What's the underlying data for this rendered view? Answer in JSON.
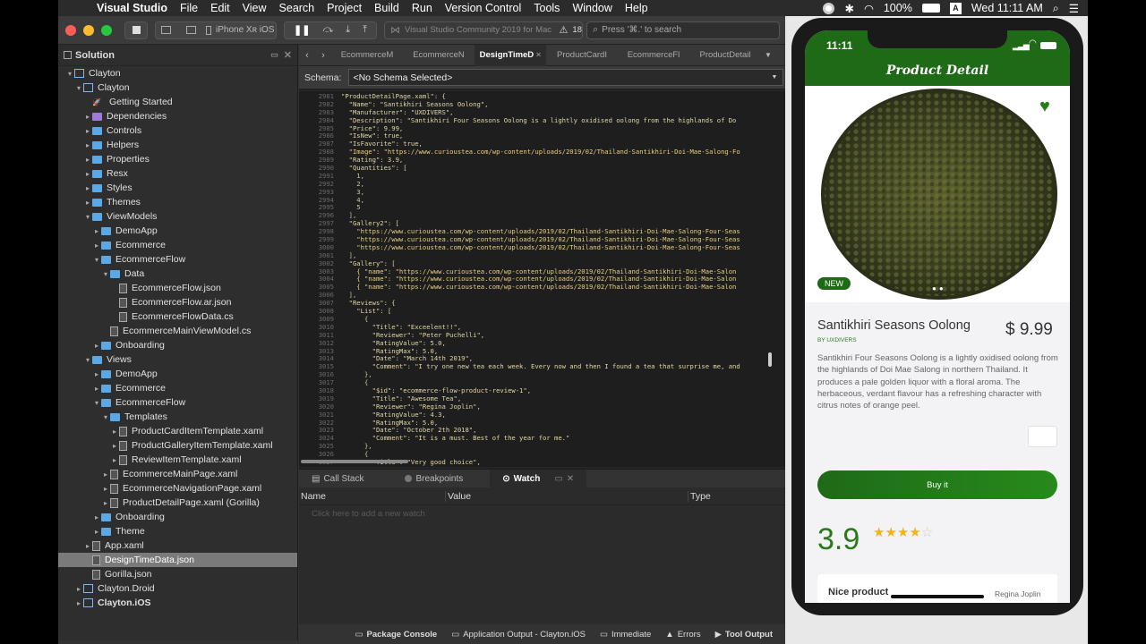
{
  "menubar": {
    "app": "Visual Studio",
    "items": [
      "File",
      "Edit",
      "View",
      "Search",
      "Project",
      "Build",
      "Run",
      "Version Control",
      "Tools",
      "Window",
      "Help"
    ],
    "battery": "100%",
    "clock": "Wed 11:11 AM"
  },
  "toolbar": {
    "device": "iPhone Xʀ iOS",
    "status": "Visual Studio Community 2019 for Mac",
    "warnings": "18",
    "search_placeholder": "Press '⌘.' to search"
  },
  "solution": {
    "title": "Solution",
    "items": [
      {
        "label": "Clayton",
        "depth": 0,
        "tw": "▾",
        "icon": "sln"
      },
      {
        "label": "Clayton",
        "depth": 1,
        "tw": "▾",
        "icon": "proj"
      },
      {
        "label": "Getting Started",
        "depth": 2,
        "tw": "",
        "icon": "rocket"
      },
      {
        "label": "Dependencies",
        "depth": 2,
        "tw": "▸",
        "icon": "purple"
      },
      {
        "label": "Controls",
        "depth": 2,
        "tw": "▸",
        "icon": "folder"
      },
      {
        "label": "Helpers",
        "depth": 2,
        "tw": "▸",
        "icon": "folder"
      },
      {
        "label": "Properties",
        "depth": 2,
        "tw": "▸",
        "icon": "folder"
      },
      {
        "label": "Resx",
        "depth": 2,
        "tw": "▸",
        "icon": "folder"
      },
      {
        "label": "Styles",
        "depth": 2,
        "tw": "▸",
        "icon": "folder"
      },
      {
        "label": "Themes",
        "depth": 2,
        "tw": "▸",
        "icon": "folder"
      },
      {
        "label": "ViewModels",
        "depth": 2,
        "tw": "▾",
        "icon": "folder"
      },
      {
        "label": "DemoApp",
        "depth": 3,
        "tw": "▸",
        "icon": "folder"
      },
      {
        "label": "Ecommerce",
        "depth": 3,
        "tw": "▸",
        "icon": "folder"
      },
      {
        "label": "EcommerceFlow",
        "depth": 3,
        "tw": "▾",
        "icon": "folder"
      },
      {
        "label": "Data",
        "depth": 4,
        "tw": "▾",
        "icon": "folder"
      },
      {
        "label": "EcommerceFlow.json",
        "depth": 5,
        "tw": "",
        "icon": "file"
      },
      {
        "label": "EcommerceFlow.ar.json",
        "depth": 5,
        "tw": "",
        "icon": "file"
      },
      {
        "label": "EcommerceFlowData.cs",
        "depth": 5,
        "tw": "",
        "icon": "file"
      },
      {
        "label": "EcommerceMainViewModel.cs",
        "depth": 4,
        "tw": "",
        "icon": "file"
      },
      {
        "label": "Onboarding",
        "depth": 3,
        "tw": "▸",
        "icon": "folder"
      },
      {
        "label": "Views",
        "depth": 2,
        "tw": "▾",
        "icon": "folder"
      },
      {
        "label": "DemoApp",
        "depth": 3,
        "tw": "▸",
        "icon": "folder"
      },
      {
        "label": "Ecommerce",
        "depth": 3,
        "tw": "▸",
        "icon": "folder"
      },
      {
        "label": "EcommerceFlow",
        "depth": 3,
        "tw": "▾",
        "icon": "folder"
      },
      {
        "label": "Templates",
        "depth": 4,
        "tw": "▾",
        "icon": "folder"
      },
      {
        "label": "ProductCardItemTemplate.xaml",
        "depth": 5,
        "tw": "▸",
        "icon": "file"
      },
      {
        "label": "ProductGalleryItemTemplate.xaml",
        "depth": 5,
        "tw": "▸",
        "icon": "file"
      },
      {
        "label": "ReviewItemTemplate.xaml",
        "depth": 5,
        "tw": "▸",
        "icon": "file"
      },
      {
        "label": "EcommerceMainPage.xaml",
        "depth": 4,
        "tw": "▸",
        "icon": "file"
      },
      {
        "label": "EcommerceNavigationPage.xaml",
        "depth": 4,
        "tw": "▸",
        "icon": "file"
      },
      {
        "label": "ProductDetailPage.xaml (Gorilla)",
        "depth": 4,
        "tw": "▸",
        "icon": "file"
      },
      {
        "label": "Onboarding",
        "depth": 3,
        "tw": "▸",
        "icon": "folder"
      },
      {
        "label": "Theme",
        "depth": 3,
        "tw": "▸",
        "icon": "folder"
      },
      {
        "label": "App.xaml",
        "depth": 2,
        "tw": "▸",
        "icon": "file"
      },
      {
        "label": "DesignTimeData.json",
        "depth": 2,
        "tw": "",
        "icon": "file",
        "selected": true
      },
      {
        "label": "Gorilla.json",
        "depth": 2,
        "tw": "",
        "icon": "file"
      },
      {
        "label": "Clayton.Droid",
        "depth": 1,
        "tw": "▸",
        "icon": "proj"
      },
      {
        "label": "Clayton.iOS",
        "depth": 1,
        "tw": "▸",
        "icon": "proj",
        "bold": true
      }
    ]
  },
  "tabs": [
    "EcommerceM",
    "EcommerceN",
    "DesignTimeD",
    "ProductCardI",
    "EcommerceFl",
    "ProductDetail"
  ],
  "schema": {
    "label": "Schema:",
    "value": "<No Schema Selected>"
  },
  "code": {
    "lines": [
      [
        "2981",
        "\"ProductDetailPage.xaml\": {"
      ],
      [
        "2982",
        "  \"Name\": \"Santikhiri Seasons Oolong\","
      ],
      [
        "2983",
        "  \"Manufacturer\": \"UXDIVERS\","
      ],
      [
        "2984",
        "  \"Description\": \"Santikhiri Four Seasons Oolong is a lightly oxidised oolong from the highlands of Do"
      ],
      [
        "2985",
        "  \"Price\": 9.99,"
      ],
      [
        "2986",
        "  \"IsNew\": true,"
      ],
      [
        "2987",
        "  \"IsFavorite\": true,"
      ],
      [
        "2988",
        "  \"Image\": \"https://www.curioustea.com/wp-content/uploads/2019/02/Thailand-Santikhiri-Doi-Mae-Salong-Fo"
      ],
      [
        "2989",
        "  \"Rating\": 3.9,"
      ],
      [
        "2990",
        "  \"Quantities\": ["
      ],
      [
        "2991",
        "    1,"
      ],
      [
        "2992",
        "    2,"
      ],
      [
        "2993",
        "    3,"
      ],
      [
        "2994",
        "    4,"
      ],
      [
        "2995",
        "    5"
      ],
      [
        "2996",
        "  ],"
      ],
      [
        "2997",
        "  \"Gallery2\": ["
      ],
      [
        "2998",
        "    \"https://www.curioustea.com/wp-content/uploads/2019/02/Thailand-Santikhiri-Doi-Mae-Salong-Four-Seas"
      ],
      [
        "2999",
        "    \"https://www.curioustea.com/wp-content/uploads/2019/02/Thailand-Santikhiri-Doi-Mae-Salong-Four-Seas"
      ],
      [
        "3000",
        "    \"https://www.curioustea.com/wp-content/uploads/2019/02/Thailand-Santikhiri-Doi-Mae-Salong-Four-Seas"
      ],
      [
        "3001",
        "  ],"
      ],
      [
        "3002",
        "  \"Gallery\": ["
      ],
      [
        "3003",
        "    { \"name\": \"https://www.curioustea.com/wp-content/uploads/2019/02/Thailand-Santikhiri-Doi-Mae-Salon"
      ],
      [
        "3004",
        "    { \"name\": \"https://www.curioustea.com/wp-content/uploads/2019/02/Thailand-Santikhiri-Doi-Mae-Salon"
      ],
      [
        "3005",
        "    { \"name\": \"https://www.curioustea.com/wp-content/uploads/2019/02/Thailand-Santikhiri-Doi-Mae-Salon"
      ],
      [
        "3006",
        "  ],"
      ],
      [
        "3007",
        "  \"Reviews\": {"
      ],
      [
        "3008",
        "    \"List\": ["
      ],
      [
        "3009",
        "      {"
      ],
      [
        "3010",
        "        \"Title\": \"Exceelent!!\","
      ],
      [
        "3011",
        "        \"Reviewer\": \"Peter Puchelli\","
      ],
      [
        "3012",
        "        \"RatingValue\": 5.0,"
      ],
      [
        "3013",
        "        \"RatingMax\": 5.0,"
      ],
      [
        "3014",
        "        \"Date\": \"March 14th 2019\","
      ],
      [
        "3015",
        "        \"Comment\": \"I try one new tea each week. Every now and then I found a tea that surprise me, and"
      ],
      [
        "3016",
        "      },"
      ],
      [
        "3017",
        "      {"
      ],
      [
        "3018",
        "        \"$id\": \"ecommerce-flow-product-review-1\","
      ],
      [
        "3019",
        "        \"Title\": \"Awesome Tea\","
      ],
      [
        "3020",
        "        \"Reviewer\": \"Regina Joplin\","
      ],
      [
        "3021",
        "        \"RatingValue\": 4.3,"
      ],
      [
        "3022",
        "        \"RatingMax\": 5.0,"
      ],
      [
        "3023",
        "        \"Date\": \"October 2th 2018\","
      ],
      [
        "3024",
        "        \"Comment\": \"It is a must. Best of the year for me.\""
      ],
      [
        "3025",
        "      },"
      ],
      [
        "3026",
        "      {"
      ],
      [
        "3027",
        "        \"Title\": \"Very good choice\","
      ]
    ]
  },
  "debug": {
    "tabs": [
      "Call Stack",
      "Breakpoints",
      "Watch"
    ],
    "columns": [
      "Name",
      "Value",
      "Type"
    ],
    "add_hint": "Click here to add a new watch"
  },
  "statusbar": [
    "Package Console",
    "Application Output - Clayton.iOS",
    "Immediate",
    "Errors",
    "Tool Output"
  ],
  "phone": {
    "time": "11:11",
    "nav_title": "Product Detail",
    "badge": "NEW",
    "product_name": "Santikhiri Seasons Oolong",
    "price": "$ 9.99",
    "manufacturer": "BY UXDIVERS",
    "description": "Santikhiri Four Seasons Oolong is a lightly oxidised oolong from the highlands of Doi Mae Salong in northern Thailand. It produces a pale golden liquor with a floral aroma. The herbaceous, verdant flavour has a refreshing character with citrus notes of orange peel.",
    "buy_label": "Buy it",
    "rating": "3.9",
    "rating_value": 3.9,
    "rating_max": 5,
    "review_title": "Nice product",
    "reviewer": "Regina Joplin"
  },
  "colors": {
    "brand_green": "#1f6a16",
    "star": "#f2b418",
    "selection": "#7a7a7a"
  }
}
